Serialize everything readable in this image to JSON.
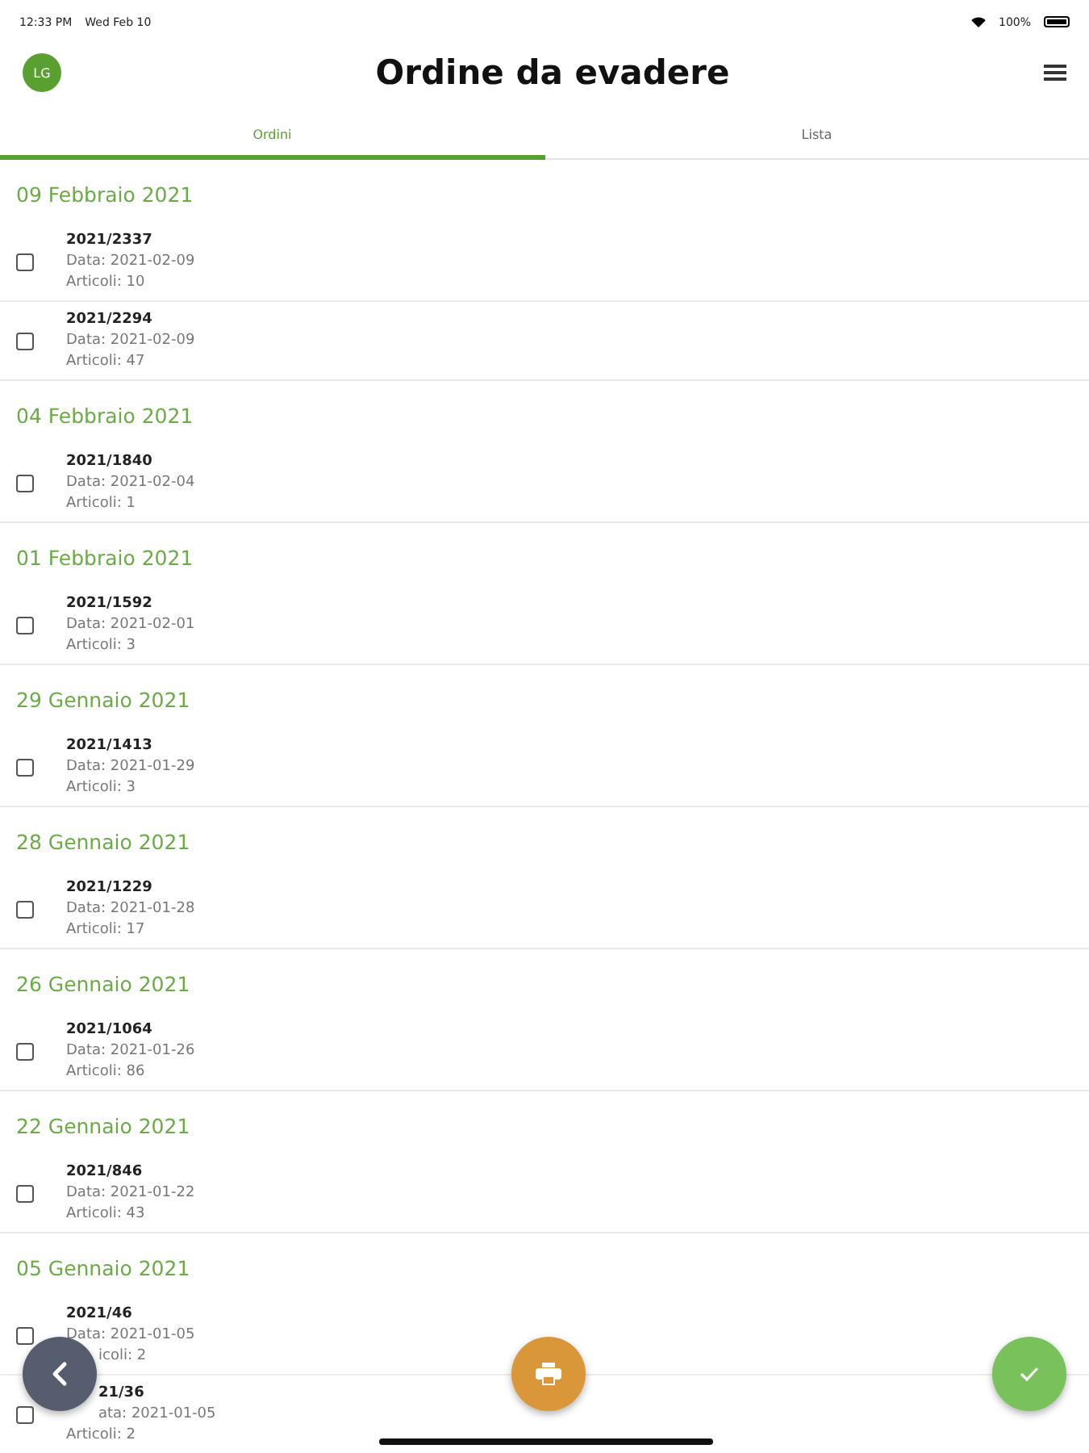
{
  "status_bar": {
    "time": "12:33 PM",
    "date": "Wed Feb 10",
    "battery": "100%"
  },
  "header": {
    "avatar": "LG",
    "title": "Ordine da evadere"
  },
  "tabs": [
    {
      "label": "Ordini",
      "selected": true
    },
    {
      "label": "Lista",
      "selected": false
    }
  ],
  "sections": [
    {
      "date": "09 Febbraio 2021",
      "orders": [
        {
          "number": "2021/2337",
          "date": "Data: 2021-02-09",
          "items": "Articoli: 10",
          "checked": false
        },
        {
          "number": "2021/2294",
          "date": "Data: 2021-02-09",
          "items": "Articoli: 47",
          "checked": false
        }
      ]
    },
    {
      "date": "04 Febbraio 2021",
      "orders": [
        {
          "number": "2021/1840",
          "date": "Data: 2021-02-04",
          "items": "Articoli: 1",
          "checked": false
        }
      ]
    },
    {
      "date": "01 Febbraio 2021",
      "orders": [
        {
          "number": "2021/1592",
          "date": "Data: 2021-02-01",
          "items": "Articoli: 3",
          "checked": false
        }
      ]
    },
    {
      "date": "29 Gennaio 2021",
      "orders": [
        {
          "number": "2021/1413",
          "date": "Data: 2021-01-29",
          "items": "Articoli: 3",
          "checked": false
        }
      ]
    },
    {
      "date": "28 Gennaio 2021",
      "orders": [
        {
          "number": "2021/1229",
          "date": "Data: 2021-01-28",
          "items": "Articoli: 17",
          "checked": false
        }
      ]
    },
    {
      "date": "26 Gennaio 2021",
      "orders": [
        {
          "number": "2021/1064",
          "date": "Data: 2021-01-26",
          "items": "Articoli: 86",
          "checked": false
        }
      ]
    },
    {
      "date": "22 Gennaio 2021",
      "orders": [
        {
          "number": "2021/846",
          "date": "Data: 2021-01-22",
          "items": "Articoli: 43",
          "checked": false
        }
      ]
    },
    {
      "date": "05 Gennaio 2021",
      "orders": [
        {
          "number": "2021/46",
          "date": "Data: 2021-01-05",
          "items": "icoli: 2",
          "checked": false,
          "covered": [
            false,
            false,
            true
          ]
        },
        {
          "number": "21/36",
          "date": "ata: 2021-01-05",
          "items": "Articoli: 2",
          "checked": false,
          "covered": [
            true,
            true,
            false
          ]
        }
      ]
    }
  ]
}
